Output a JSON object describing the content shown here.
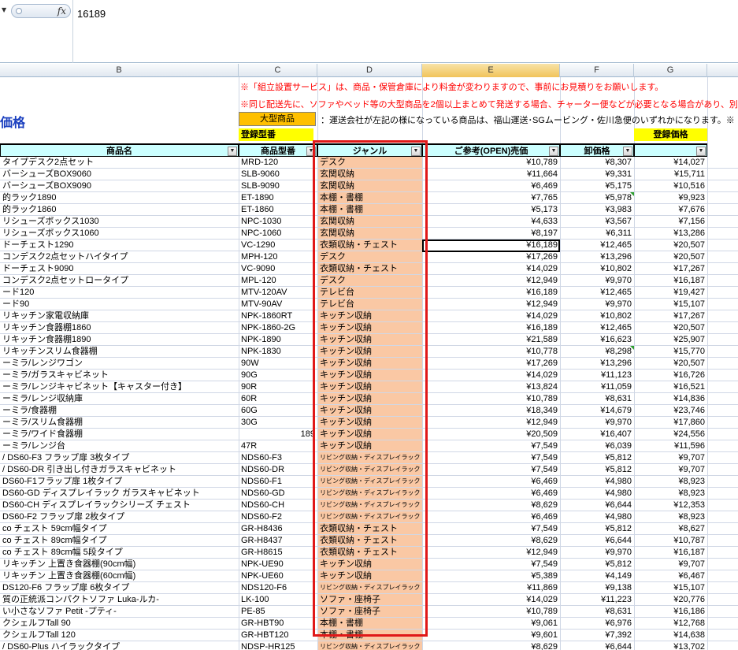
{
  "formula_bar": {
    "fx_label": "fx",
    "value": "16189"
  },
  "columns": [
    "B",
    "C",
    "D",
    "E",
    "F",
    "G"
  ],
  "notes": {
    "line1": "※「組立設置サービス」は、商品・保管倉庫により料金が変わりますので、事前にお見積りをお願いします。",
    "line2": "※同じ配送先に、ソファやベッド等の大型商品を2個以上まとめて発送する場合、チャーター便などが必要となる場合があり、別"
  },
  "title": "価格",
  "big_item": {
    "label": "大型商品",
    "description": "：運送会社が左記の様になっている商品は、福山運送･SGムービング・佐川急便のいずれかになります。※"
  },
  "registration": {
    "model_label": "登録型番",
    "price_label": "登録価格"
  },
  "table": {
    "headers": [
      "商品名",
      "商品型番",
      "ジャンル",
      "ご参考(OPEN)売価",
      "卸価格"
    ],
    "rows": [
      [
        "タイプデスク2点セット",
        "MRD-120",
        "デスク",
        "¥10,789",
        "¥8,307",
        "¥14,027"
      ],
      [
        "バーシューズBOX9060",
        "SLB-9060",
        "玄関収納",
        "¥11,664",
        "¥9,331",
        "¥15,711"
      ],
      [
        "バーシューズBOX9090",
        "SLB-9090",
        "玄関収納",
        "¥6,469",
        "¥5,175",
        "¥10,516"
      ],
      [
        "的ラック1890",
        "ET-1890",
        "本棚・書棚",
        "¥7,765",
        "¥5,978",
        "¥9,923"
      ],
      [
        "的ラック1860",
        "ET-1860",
        "本棚・書棚",
        "¥5,173",
        "¥3,983",
        "¥7,676"
      ],
      [
        "リシューズボックス1030",
        "NPC-1030",
        "玄関収納",
        "¥4,633",
        "¥3,567",
        "¥7,156"
      ],
      [
        "リシューズボックス1060",
        "NPC-1060",
        "玄関収納",
        "¥8,197",
        "¥6,311",
        "¥13,286"
      ],
      [
        "ドーチェスト1290",
        "VC-1290",
        "衣類収納・チェスト",
        "¥16,189",
        "¥12,465",
        "¥20,507"
      ],
      [
        "コンデスク2点セットハイタイプ",
        "MPH-120",
        "デスク",
        "¥17,269",
        "¥13,296",
        "¥20,507"
      ],
      [
        "ドーチェスト9090",
        "VC-9090",
        "衣類収納・チェスト",
        "¥14,029",
        "¥10,802",
        "¥17,267"
      ],
      [
        "コンデスク2点セットロータイプ",
        "MPL-120",
        "デスク",
        "¥12,949",
        "¥9,970",
        "¥16,187"
      ],
      [
        "ード120",
        "MTV-120AV",
        "テレビ台",
        "¥16,189",
        "¥12,465",
        "¥19,427"
      ],
      [
        "ード90",
        "MTV-90AV",
        "テレビ台",
        "¥12,949",
        "¥9,970",
        "¥15,107"
      ],
      [
        "リキッチン家電収納庫",
        "NPK-1860RT",
        "キッチン収納",
        "¥14,029",
        "¥10,802",
        "¥17,267"
      ],
      [
        "リキッチン食器棚1860",
        "NPK-1860-2G",
        "キッチン収納",
        "¥16,189",
        "¥12,465",
        "¥20,507"
      ],
      [
        "リキッチン食器棚1890",
        "NPK-1890",
        "キッチン収納",
        "¥21,589",
        "¥16,623",
        "¥25,907"
      ],
      [
        "リキッチンスリム食器棚",
        "NPK-1830",
        "キッチン収納",
        "¥10,778",
        "¥8,298",
        "¥15,770"
      ],
      [
        "ーミラ/レンジワゴン",
        "90W",
        "キッチン収納",
        "¥17,269",
        "¥13,296",
        "¥20,507"
      ],
      [
        "ーミラ/ガラスキャビネット",
        "90G",
        "キッチン収納",
        "¥14,029",
        "¥11,123",
        "¥16,726"
      ],
      [
        "ーミラ/レンジキャビネット【キャスター付き】",
        "90R",
        "キッチン収納",
        "¥13,824",
        "¥11,059",
        "¥16,521"
      ],
      [
        "ーミラ/レンジ収納庫",
        "60R",
        "キッチン収納",
        "¥10,789",
        "¥8,631",
        "¥14,836"
      ],
      [
        "ーミラ/食器棚",
        "60G",
        "キッチン収納",
        "¥18,349",
        "¥14,679",
        "¥23,746"
      ],
      [
        "ーミラ/スリム食器棚",
        "30G",
        "キッチン収納",
        "¥12,949",
        "¥9,970",
        "¥17,860"
      ],
      [
        "ーミラ/ワイド食器棚",
        "189",
        "キッチン収納",
        "¥20,509",
        "¥16,407",
        "¥24,556"
      ],
      [
        "ーミラ/レンジ台",
        "47R",
        "キッチン収納",
        "¥7,549",
        "¥6,039",
        "¥11,596"
      ],
      [
        "/ DS60-F3 フラップ扉 3枚タイプ",
        "NDS60-F3",
        "リビング収納・ディスプレイラック",
        "¥7,549",
        "¥5,812",
        "¥9,707"
      ],
      [
        "/ DS60-DR 引き出し付きガラスキャビネット",
        "NDS60-DR",
        "リビング収納・ディスプレイラック",
        "¥7,549",
        "¥5,812",
        "¥9,707"
      ],
      [
        " DS60-F1フラップ扉 1枚タイプ",
        "NDS60-F1",
        "リビング収納・ディスプレイラック",
        "¥6,469",
        "¥4,980",
        "¥8,923"
      ],
      [
        " DS60-GD ディスプレイラック ガラスキャビネット",
        "NDS60-GD",
        "リビング収納・ディスプレイラック",
        "¥6,469",
        "¥4,980",
        "¥8,923"
      ],
      [
        " DS60-CH ディスプレイラックシリーズ チェスト",
        "NDS60-CH",
        "リビング収納・ディスプレイラック",
        "¥8,629",
        "¥6,644",
        "¥12,353"
      ],
      [
        " DS60-F2 フラップ扉 2枚タイプ",
        "NDS60-F2",
        "リビング収納・ディスプレイラック",
        "¥6,469",
        "¥4,980",
        "¥8,923"
      ],
      [
        "co チェスト 59cm幅タイプ",
        "GR-H8436",
        "衣類収納・チェスト",
        "¥7,549",
        "¥5,812",
        "¥8,627"
      ],
      [
        "co チェスト 89cm幅タイプ",
        "GR-H8437",
        "衣類収納・チェスト",
        "¥8,629",
        "¥6,644",
        "¥10,787"
      ],
      [
        "co チェスト 89cm幅 5段タイプ",
        "GR-H8615",
        "衣類収納・チェスト",
        "¥12,949",
        "¥9,970",
        "¥16,187"
      ],
      [
        "リキッチン 上置き食器棚(90cm幅)",
        "NPK-UE90",
        "キッチン収納",
        "¥7,549",
        "¥5,812",
        "¥9,707"
      ],
      [
        "リキッチン 上置き食器棚(60cm幅)",
        "NPK-UE60",
        "キッチン収納",
        "¥5,389",
        "¥4,149",
        "¥6,467"
      ],
      [
        " DS120-F6 フラップ扉 6枚タイプ",
        "NDS120-F6",
        "リビング収納・ディスプレイラック",
        "¥11,869",
        "¥9,138",
        "¥15,107"
      ],
      [
        "質の正統派コンパクトソファ Luka-ルカ-",
        "LK-100",
        "ソファ・座椅子",
        "¥14,029",
        "¥11,223",
        "¥20,776"
      ],
      [
        "い小さなソファ Petit -プティ-",
        "PE-85",
        "ソファ・座椅子",
        "¥10,789",
        "¥8,631",
        "¥16,186"
      ],
      [
        "クシェルフTall 90",
        "GR-HBT90",
        "本棚・書棚",
        "¥9,061",
        "¥6,976",
        "¥12,768"
      ],
      [
        "クシェルフTall 120",
        "GR-HBT120",
        "本棚・書棚",
        "¥9,601",
        "¥7,392",
        "¥14,638"
      ],
      [
        "/ DS60-Plus ハイラックタイプ",
        "NDSP-HR125",
        "リビング収納・ディスプレイラック",
        "¥8,629",
        "¥6,644",
        "¥13,702"
      ]
    ]
  },
  "colors": {
    "genre_fill": "#fac8a4",
    "header_fill": "#ccffff",
    "highlight_box": "#e01818",
    "note_text": "#ff0000",
    "title_text": "#1a3fbf",
    "yellow": "#ffff00",
    "orange": "#ffc000"
  }
}
